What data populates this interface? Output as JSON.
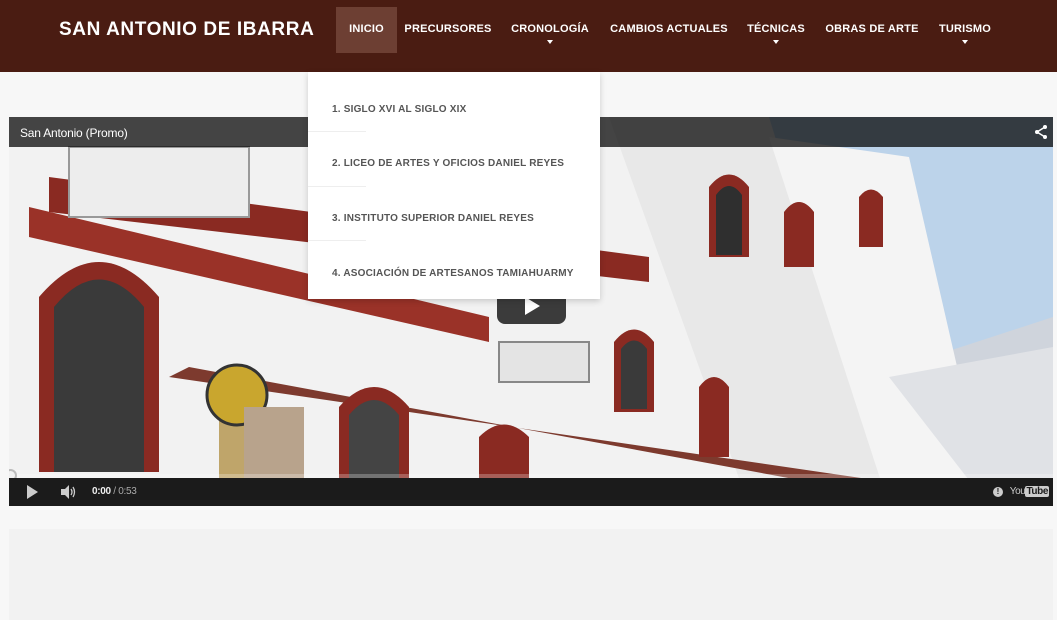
{
  "site": {
    "brand": "SAN ANTONIO DE IBARRA"
  },
  "nav": {
    "items": [
      {
        "label": "INICIO",
        "active": true,
        "caret": false
      },
      {
        "label": "PRECURSORES",
        "active": false,
        "caret": false
      },
      {
        "label": "CRONOLOGÍA",
        "active": false,
        "caret": true
      },
      {
        "label": "CAMBIOS ACTUALES",
        "active": false,
        "caret": false
      },
      {
        "label": "TÉCNICAS",
        "active": false,
        "caret": true
      },
      {
        "label": "OBRAS DE ARTE",
        "active": false,
        "caret": false
      },
      {
        "label": "TURISMO",
        "active": false,
        "caret": true
      }
    ]
  },
  "dropdown": {
    "items": [
      "1. SIGLO XVI AL SIGLO XIX",
      "2. LICEO DE ARTES Y OFICIOS DANIEL REYES",
      "3. INSTITUTO SUPERIOR DANIEL REYES",
      "4. ASOCIACIÓN DE ARTESANOS TAMIAHUARMY"
    ]
  },
  "video": {
    "title": "San Antonio (Promo)",
    "time_current": "0:00",
    "time_total": " / 0:53",
    "progress": 0,
    "provider_left": "You",
    "provider_right": "Tube",
    "icons": {
      "share": "share-icon",
      "play": "play-icon",
      "volume": "volume-icon",
      "info": "info-icon"
    }
  },
  "colors": {
    "navbar": "#4a1c12",
    "active_nav": "#6d3f33",
    "dropdown_text": "#555555"
  }
}
